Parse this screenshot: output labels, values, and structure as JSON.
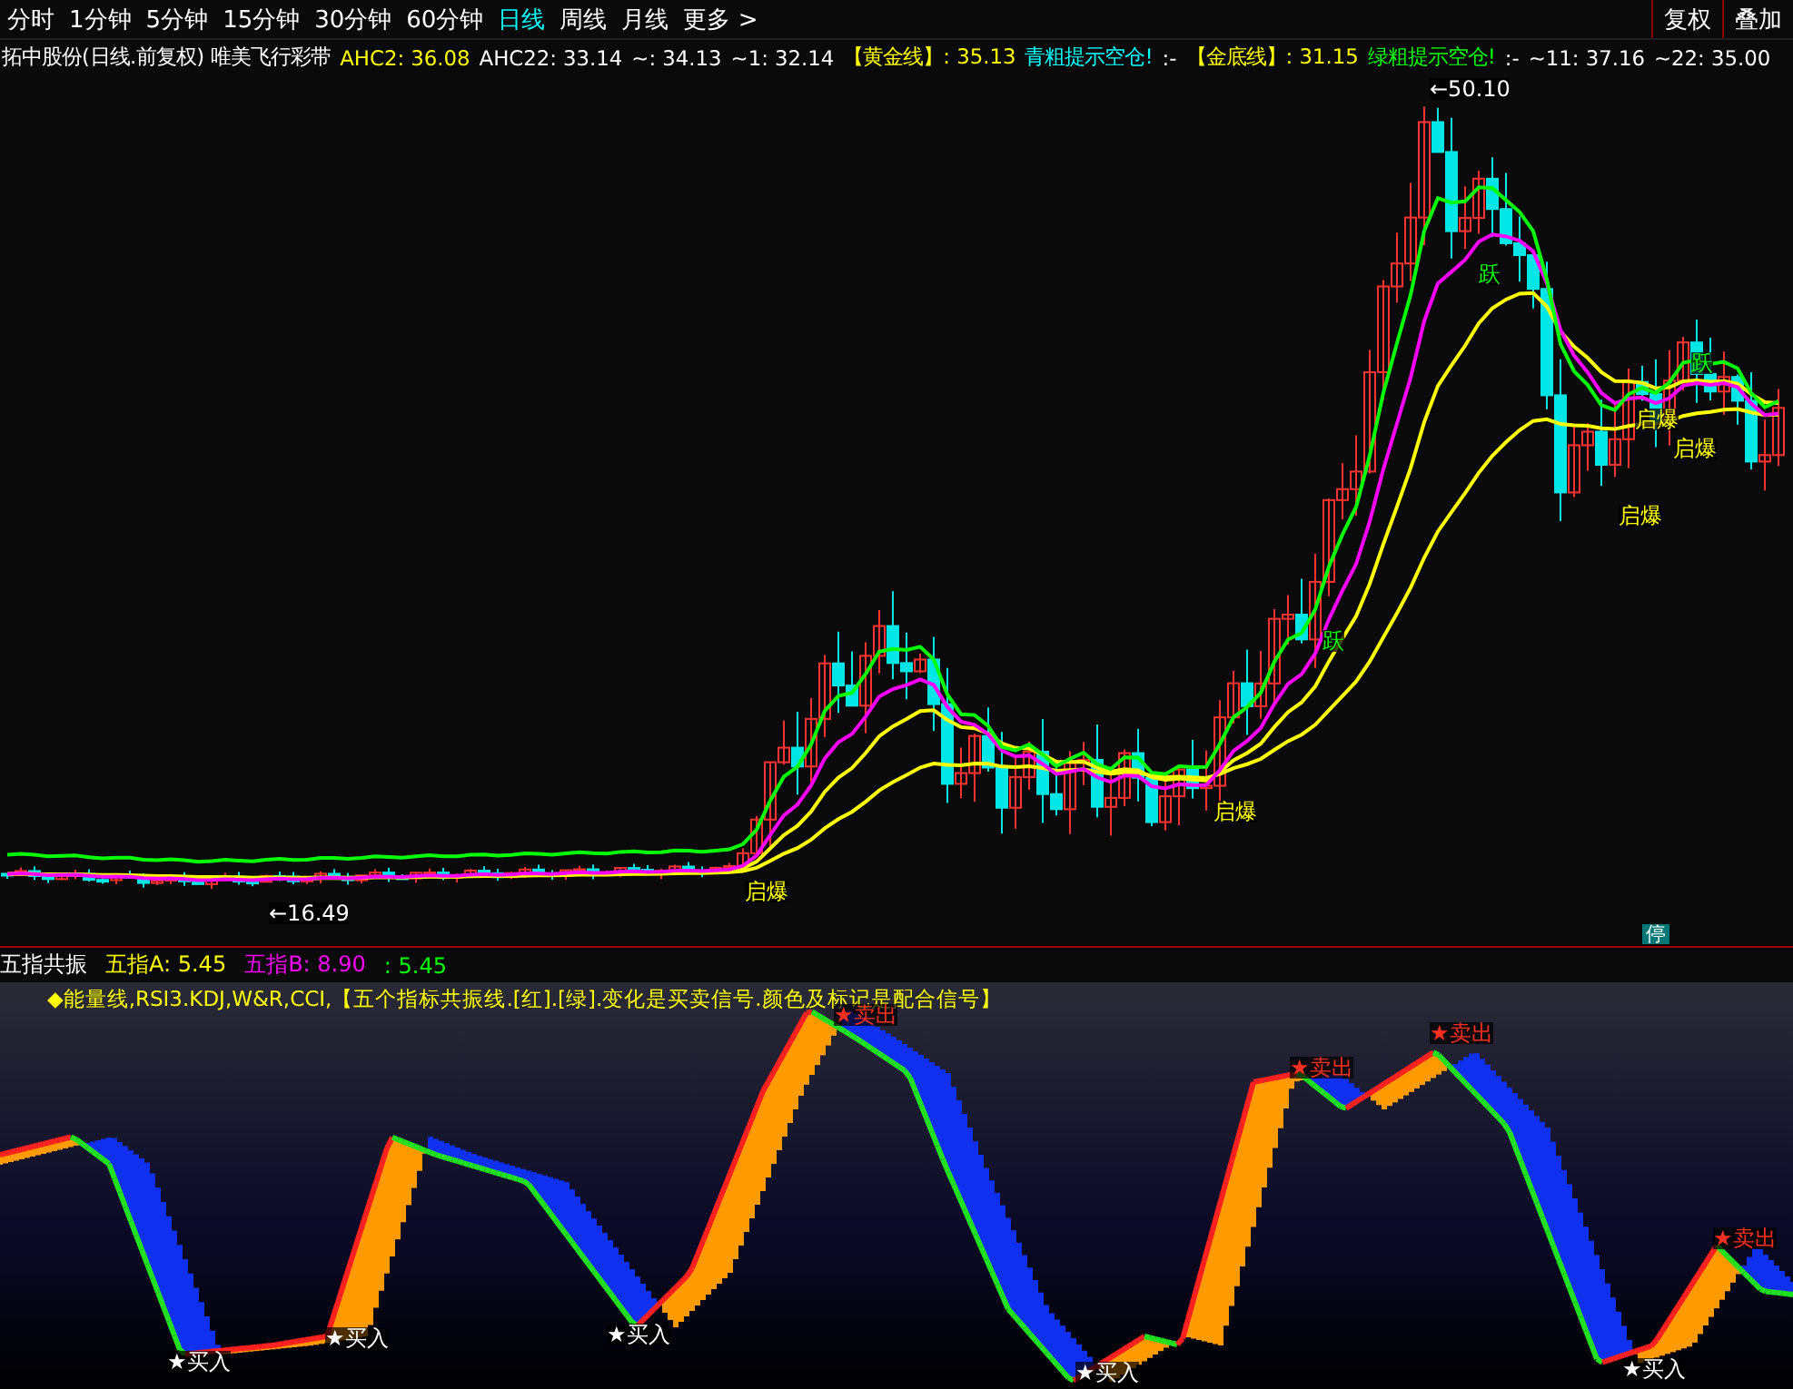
{
  "toolbar": {
    "tabs": [
      {
        "label": "分时",
        "selected": false
      },
      {
        "label": "1分钟",
        "selected": false
      },
      {
        "label": "5分钟",
        "selected": false
      },
      {
        "label": "15分钟",
        "selected": false
      },
      {
        "label": "30分钟",
        "selected": false
      },
      {
        "label": "60分钟",
        "selected": false
      },
      {
        "label": "日线",
        "selected": true
      },
      {
        "label": "周线",
        "selected": false
      },
      {
        "label": "月线",
        "selected": false
      },
      {
        "label": "更多 >",
        "selected": false
      }
    ],
    "buttons": [
      "复权",
      "叠加"
    ]
  },
  "info_line": [
    {
      "text": "拓中股份(日线.前复权) 唯美飞行彩带",
      "color": "#ffffff"
    },
    {
      "text": "AHC2: 36.08",
      "color": "#ffff00"
    },
    {
      "text": "AHC22: 33.14",
      "color": "#ffffff"
    },
    {
      "text": "~: 34.13",
      "color": "#ffffff"
    },
    {
      "text": "~1: 32.14",
      "color": "#ffffff"
    },
    {
      "text": "【黄金线】: 35.13",
      "color": "#ffff00"
    },
    {
      "text": "青粗提示空仓!",
      "color": "#00ffff"
    },
    {
      "text": ":-",
      "color": "#ffffff"
    },
    {
      "text": "【金底线】: 31.15",
      "color": "#ffff00"
    },
    {
      "text": "绿粗提示空仓!",
      "color": "#00ff00"
    },
    {
      "text": ":-",
      "color": "#ffffff"
    },
    {
      "text": "~11: 37.16",
      "color": "#ffffff"
    },
    {
      "text": "~22: 35.00",
      "color": "#ffffff"
    }
  ],
  "price_chart": {
    "labels": [
      {
        "text": "←50.10",
        "kind": "price"
      },
      {
        "text": "←16.49",
        "kind": "price"
      },
      {
        "text": "跃",
        "kind": "jump"
      },
      {
        "text": "跃",
        "kind": "jump"
      },
      {
        "text": "跃",
        "kind": "jump"
      },
      {
        "text": "启爆",
        "kind": "burst"
      },
      {
        "text": "启爆",
        "kind": "burst"
      },
      {
        "text": "启爆",
        "kind": "burst"
      },
      {
        "text": "启爆",
        "kind": "burst"
      },
      {
        "text": "启爆",
        "kind": "burst"
      },
      {
        "text": "停",
        "kind": "stop"
      }
    ]
  },
  "indicator": {
    "title": "五指共振",
    "values": [
      {
        "text": "五指A: 5.45",
        "color": "#ffff00"
      },
      {
        "text": "五指B: 8.90",
        "color": "#ff00ff"
      },
      {
        "text": ": 5.45",
        "color": "#00ff00"
      }
    ],
    "description": "◆能量线,RSI3.KDJ,W&R,CCI,【五个指标共振线.[红].[绿].变化是买卖信号.颜色及标记是配合信号】",
    "signals": [
      {
        "text": "★买入",
        "kind": "buy"
      },
      {
        "text": "★买入",
        "kind": "buy"
      },
      {
        "text": "★买入",
        "kind": "buy"
      },
      {
        "text": "★买入",
        "kind": "buy"
      },
      {
        "text": "★买入",
        "kind": "buy"
      },
      {
        "text": "★卖出",
        "kind": "sell"
      },
      {
        "text": "★卖出",
        "kind": "sell"
      },
      {
        "text": "★卖出",
        "kind": "sell"
      },
      {
        "text": "★卖出",
        "kind": "sell"
      }
    ]
  }
}
